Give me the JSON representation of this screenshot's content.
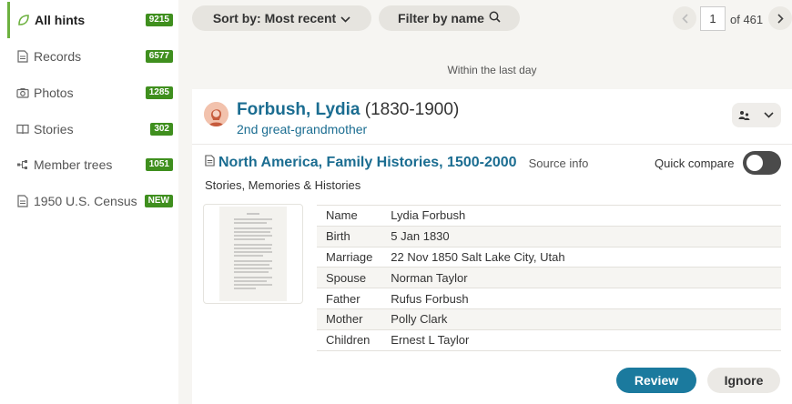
{
  "sidebar": {
    "items": [
      {
        "label": "All hints",
        "badge": "9215",
        "icon": "leaf-icon"
      },
      {
        "label": "Records",
        "badge": "6577",
        "icon": "document-icon"
      },
      {
        "label": "Photos",
        "badge": "1285",
        "icon": "camera-icon"
      },
      {
        "label": "Stories",
        "badge": "302",
        "icon": "book-icon"
      },
      {
        "label": "Member trees",
        "badge": "1051",
        "icon": "tree-icon"
      },
      {
        "label": "1950 U.S. Census",
        "badge": "NEW",
        "icon": "document-icon"
      }
    ]
  },
  "toolbar": {
    "sort_label": "Sort by: Most recent",
    "filter_label": "Filter by name",
    "page_value": "1",
    "page_of": "of 461"
  },
  "group_label": "Within the last day",
  "hint": {
    "person_name": "Forbush, Lydia",
    "person_years": "(1830-1900)",
    "relation": "2nd great-grandmother",
    "record_title": "North America, Family Histories, 1500-2000",
    "source_info": "Source info",
    "quick_compare": "Quick compare",
    "collection": "Stories, Memories & Histories",
    "details": [
      {
        "key": "Name",
        "value": "Lydia Forbush"
      },
      {
        "key": "Birth",
        "value": "5 Jan 1830"
      },
      {
        "key": "Marriage",
        "value": "22 Nov 1850 Salt Lake City, Utah"
      },
      {
        "key": "Spouse",
        "value": "Norman Taylor"
      },
      {
        "key": "Father",
        "value": "Rufus Forbush"
      },
      {
        "key": "Mother",
        "value": "Polly Clark"
      },
      {
        "key": "Children",
        "value": "Ernest L Taylor"
      }
    ],
    "review_label": "Review",
    "ignore_label": "Ignore"
  },
  "colors": {
    "accent_green": "#3f8f1e",
    "link_blue": "#1b6d91",
    "review_blue": "#1b7a9e"
  }
}
